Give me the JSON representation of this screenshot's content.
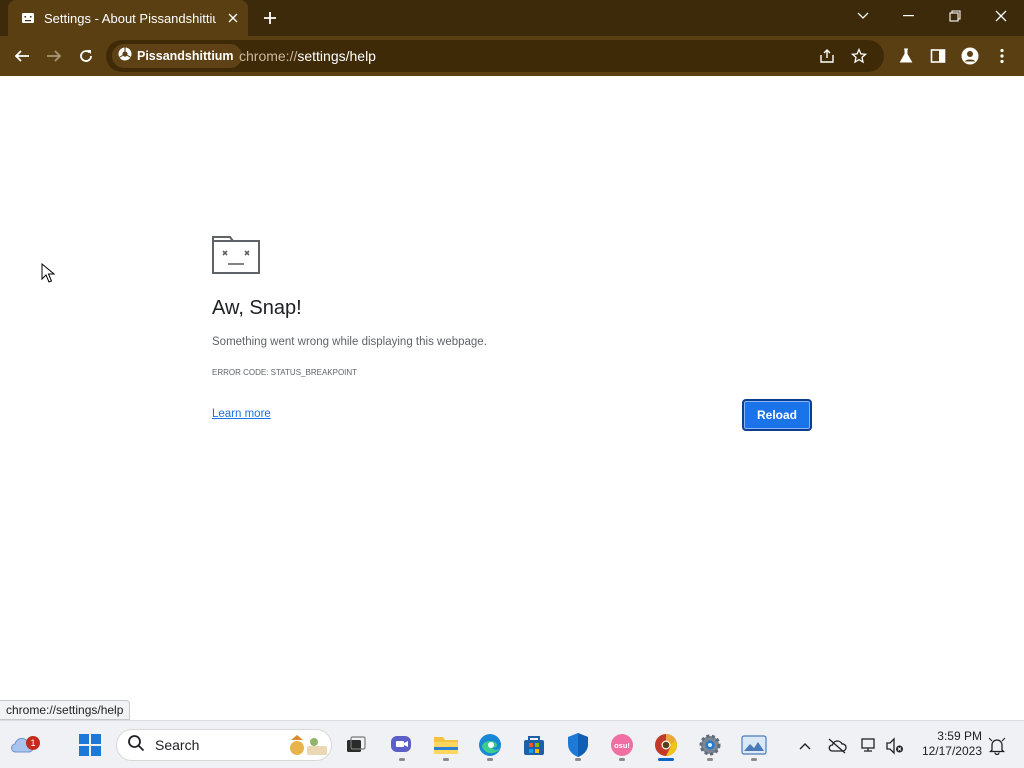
{
  "browser": {
    "tab_title": "Settings - About Pissandshittium",
    "site_chip_label": "Pissandshittium",
    "url_scheme": "chrome://",
    "url_path": "settings/help"
  },
  "page": {
    "heading": "Aw, Snap!",
    "message": "Something went wrong while displaying this webpage.",
    "error_code": "Error code: STATUS_BREAKPOINT",
    "learn_more": "Learn more",
    "reload": "Reload"
  },
  "status_bar": {
    "url": "chrome://settings/help"
  },
  "taskbar": {
    "search_label": "Search",
    "time": "3:59 PM",
    "date": "12/17/2023",
    "weather_badge": "1",
    "pinned_apps": [
      "windows-start",
      "search",
      "widgets",
      "file-explorer-task-view",
      "teams-chat",
      "file-explorer",
      "edge",
      "store",
      "defender",
      "osu",
      "browser",
      "settings",
      "photos"
    ]
  },
  "colors": {
    "tab_strip": "#3c2a0b",
    "toolbar": "#5a3f12",
    "accent": "#1a73e8"
  }
}
